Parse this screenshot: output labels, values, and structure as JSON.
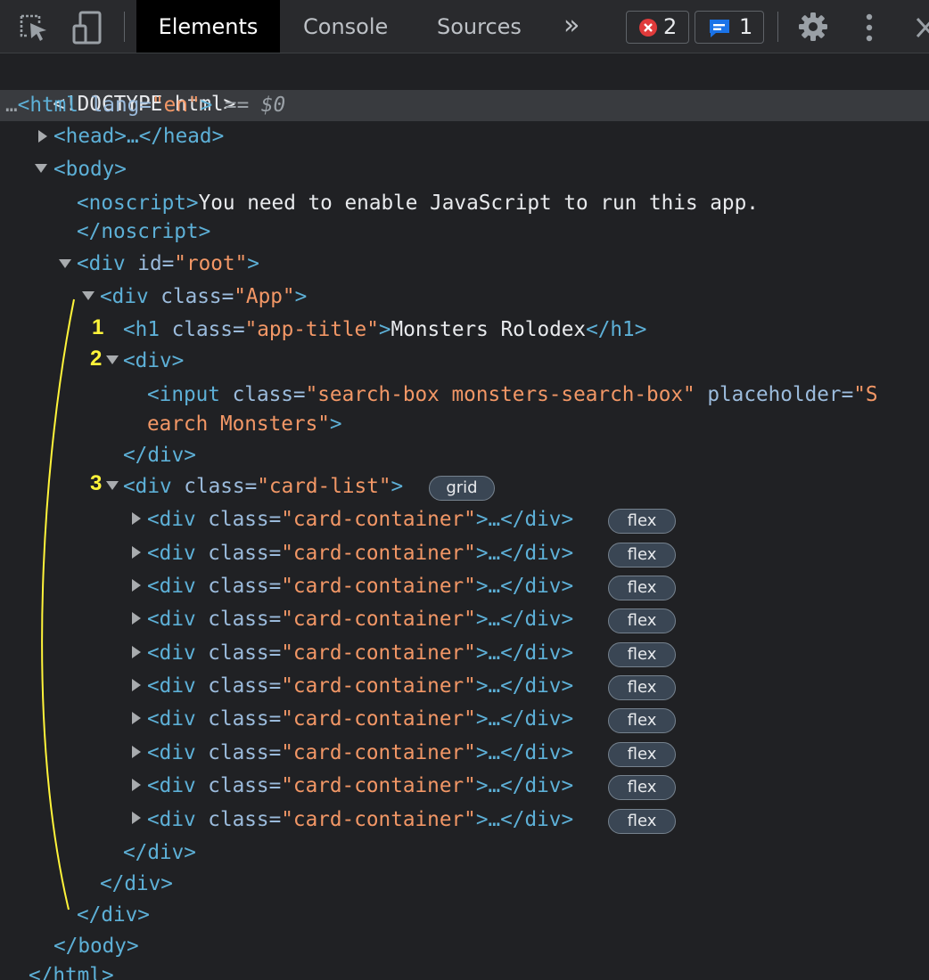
{
  "toolbar": {
    "tabs": [
      "Elements",
      "Console",
      "Sources"
    ],
    "more_tabs_glyph": "»",
    "error_count": "2",
    "issue_count": "1",
    "icons": {
      "inspect": "inspect-element-icon",
      "device": "device-toolbar-icon",
      "error": "error-circle-icon",
      "issue": "message-icon",
      "settings": "gear-icon",
      "menu": "kebab-menu-icon",
      "close": "close-icon"
    }
  },
  "tree": {
    "doctype": "<!DOCTYPE html>",
    "html_open_tag": "<html",
    "html_lang_attr": " lang=",
    "html_lang_val": "\"en\"",
    "html_close_bracket": ">",
    "selected_marker": " == $0",
    "head": "<head>…</head>",
    "body_open": "<body>",
    "noscript_open": "<noscript>",
    "noscript_text": "You need to enable JavaScript to run this app.",
    "noscript_close": "</noscript>",
    "root_open_tag": "<div",
    "root_attr": " id=",
    "root_val": "\"root\"",
    "app_open_tag": "<div",
    "app_attr": " class=",
    "app_val": "\"App\"",
    "h1_open_tag": "<h1",
    "h1_attr": " class=",
    "h1_val": "\"app-title\"",
    "h1_text": "Monsters Rolodex",
    "h1_close": "</h1>",
    "div_open": "<div>",
    "input_open_tag": "<input",
    "input_class_attr": " class=",
    "input_class_val": "\"search-box monsters-search-box\"",
    "input_placeholder_attr": " placeholder=",
    "input_placeholder_val_part1": "\"S",
    "input_placeholder_val_part2": "earch Monsters\"",
    "div_close": "</div>",
    "cardlist_open_tag": "<div",
    "cardlist_attr": " class=",
    "cardlist_val": "\"card-list\"",
    "grid_badge": "grid",
    "card_container_tag": "<div",
    "card_container_attr": " class=",
    "card_container_val": "\"card-container\"",
    "card_container_rest": "…</div>",
    "flex_badge": "flex",
    "body_close": "</body>",
    "html_close": "</html>"
  },
  "annotations": [
    "1",
    "2",
    "3"
  ],
  "colors": {
    "background": "#202124",
    "toolbar": "#292a2d",
    "active_tab": "#000000",
    "tag": "#5db0d7",
    "attribute": "#9bbbdc",
    "value": "#f29766",
    "annotation": "#fff43a",
    "error_badge": "#e03b3b",
    "issue_badge": "#1a73e8"
  }
}
